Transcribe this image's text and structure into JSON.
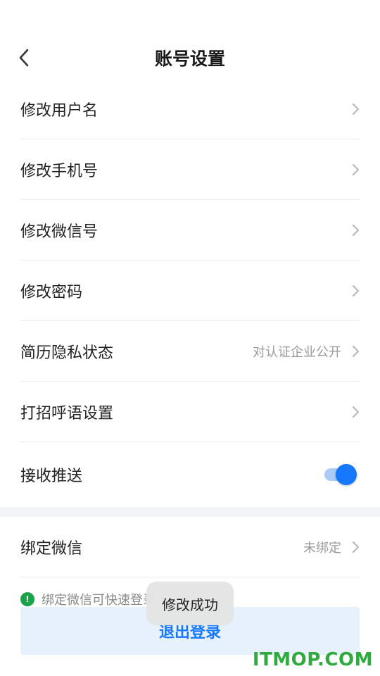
{
  "header": {
    "title": "账号设置"
  },
  "settings": [
    {
      "label": "修改用户名",
      "value": ""
    },
    {
      "label": "修改手机号",
      "value": ""
    },
    {
      "label": "修改微信号",
      "value": ""
    },
    {
      "label": "修改密码",
      "value": ""
    },
    {
      "label": "简历隐私状态",
      "value": "对认证企业公开"
    },
    {
      "label": "打招呼语设置",
      "value": ""
    }
  ],
  "push": {
    "label": "接收推送",
    "enabled": true
  },
  "wechat": {
    "label": "绑定微信",
    "value": "未绑定"
  },
  "hint": {
    "text": "绑定微信可快速登录"
  },
  "logout": {
    "label": "退出登录"
  },
  "toast": {
    "text": "修改成功"
  },
  "watermark": {
    "text": "ITMOP.COM"
  },
  "colors": {
    "accent": "#1677ff",
    "accent_light": "#e6f1fd",
    "hint_icon": "#1aa34a",
    "watermark": "#2faa3f"
  }
}
